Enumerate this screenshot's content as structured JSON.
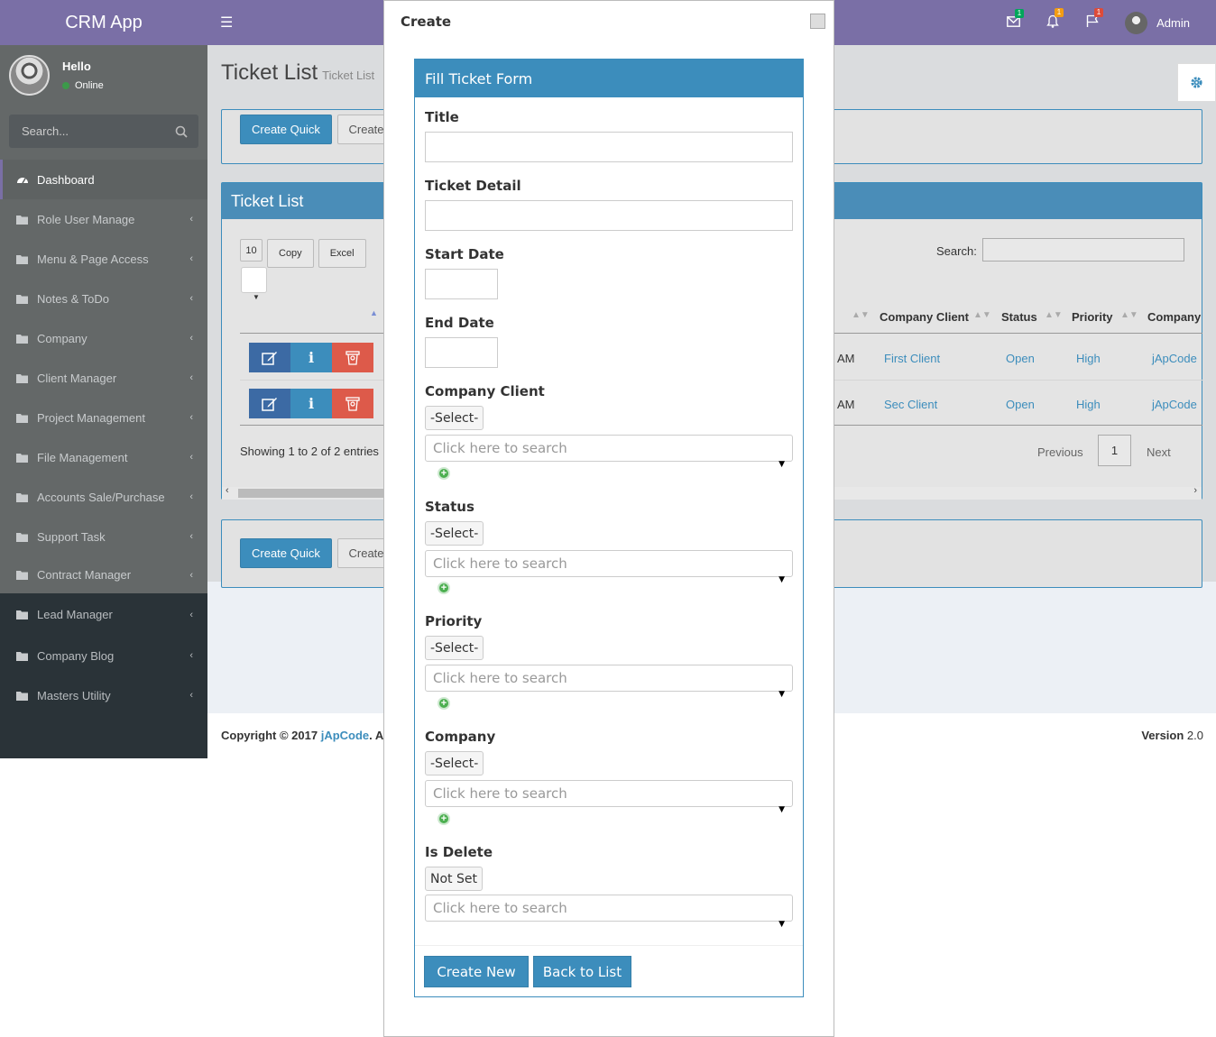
{
  "brand": "CRM App",
  "user": {
    "greeting": "Hello",
    "status": "Online"
  },
  "sidebar_search_placeholder": "Search...",
  "nav": [
    {
      "label": "Dashboard",
      "active": true
    },
    {
      "label": "Role User Manage"
    },
    {
      "label": "Menu & Page Access"
    },
    {
      "label": "Notes & ToDo"
    },
    {
      "label": "Company"
    },
    {
      "label": "Client Manager"
    },
    {
      "label": "Project Management"
    },
    {
      "label": "File Management"
    },
    {
      "label": "Accounts Sale/Purchase"
    },
    {
      "label": "Support Task"
    },
    {
      "label": "Contract Manager"
    },
    {
      "label": "Lead Manager"
    },
    {
      "label": "Company Blog"
    },
    {
      "label": "Masters Utility"
    }
  ],
  "header": {
    "badges": {
      "mail": "1",
      "bell": "1",
      "flag": "1"
    },
    "admin": "Admin"
  },
  "page": {
    "title": "Ticket List",
    "subtitle": "Ticket List"
  },
  "toolbar": {
    "create_quick": "Create Quick",
    "create": "Create"
  },
  "list": {
    "title": "Ticket List",
    "page_length": "10",
    "buttons": {
      "copy": "Copy",
      "excel": "Excel"
    },
    "search_label": "Search:",
    "columns": [
      "Company Client",
      "Status",
      "Priority",
      "Company"
    ],
    "rows": [
      {
        "time": "AM",
        "client": "First Client",
        "status": "Open",
        "priority": "High",
        "company": "jApCode"
      },
      {
        "time": "AM",
        "client": "Sec Client",
        "status": "Open",
        "priority": "High",
        "company": "jApCode"
      }
    ],
    "info": "Showing 1 to 2 of 2 entries",
    "pager": {
      "previous": "Previous",
      "page": "1",
      "next": "Next"
    }
  },
  "footer": {
    "copyright": "Copyright © 2017 ",
    "brand": "jApCode",
    "rest": ". Al",
    "version_label": "Version",
    "version": "2.0"
  },
  "modal": {
    "title": "Create",
    "form_title": "Fill Ticket Form",
    "fields": {
      "title": "Title",
      "detail": "Ticket Detail",
      "start": "Start Date",
      "end": "End Date",
      "client": "Company Client",
      "status": "Status",
      "priority": "Priority",
      "company": "Company",
      "is_delete": "Is Delete"
    },
    "select_default": "-Select-",
    "not_set": "Not Set",
    "search_placeholder": "Click here to search",
    "create_new": "Create New",
    "back": "Back to List"
  }
}
